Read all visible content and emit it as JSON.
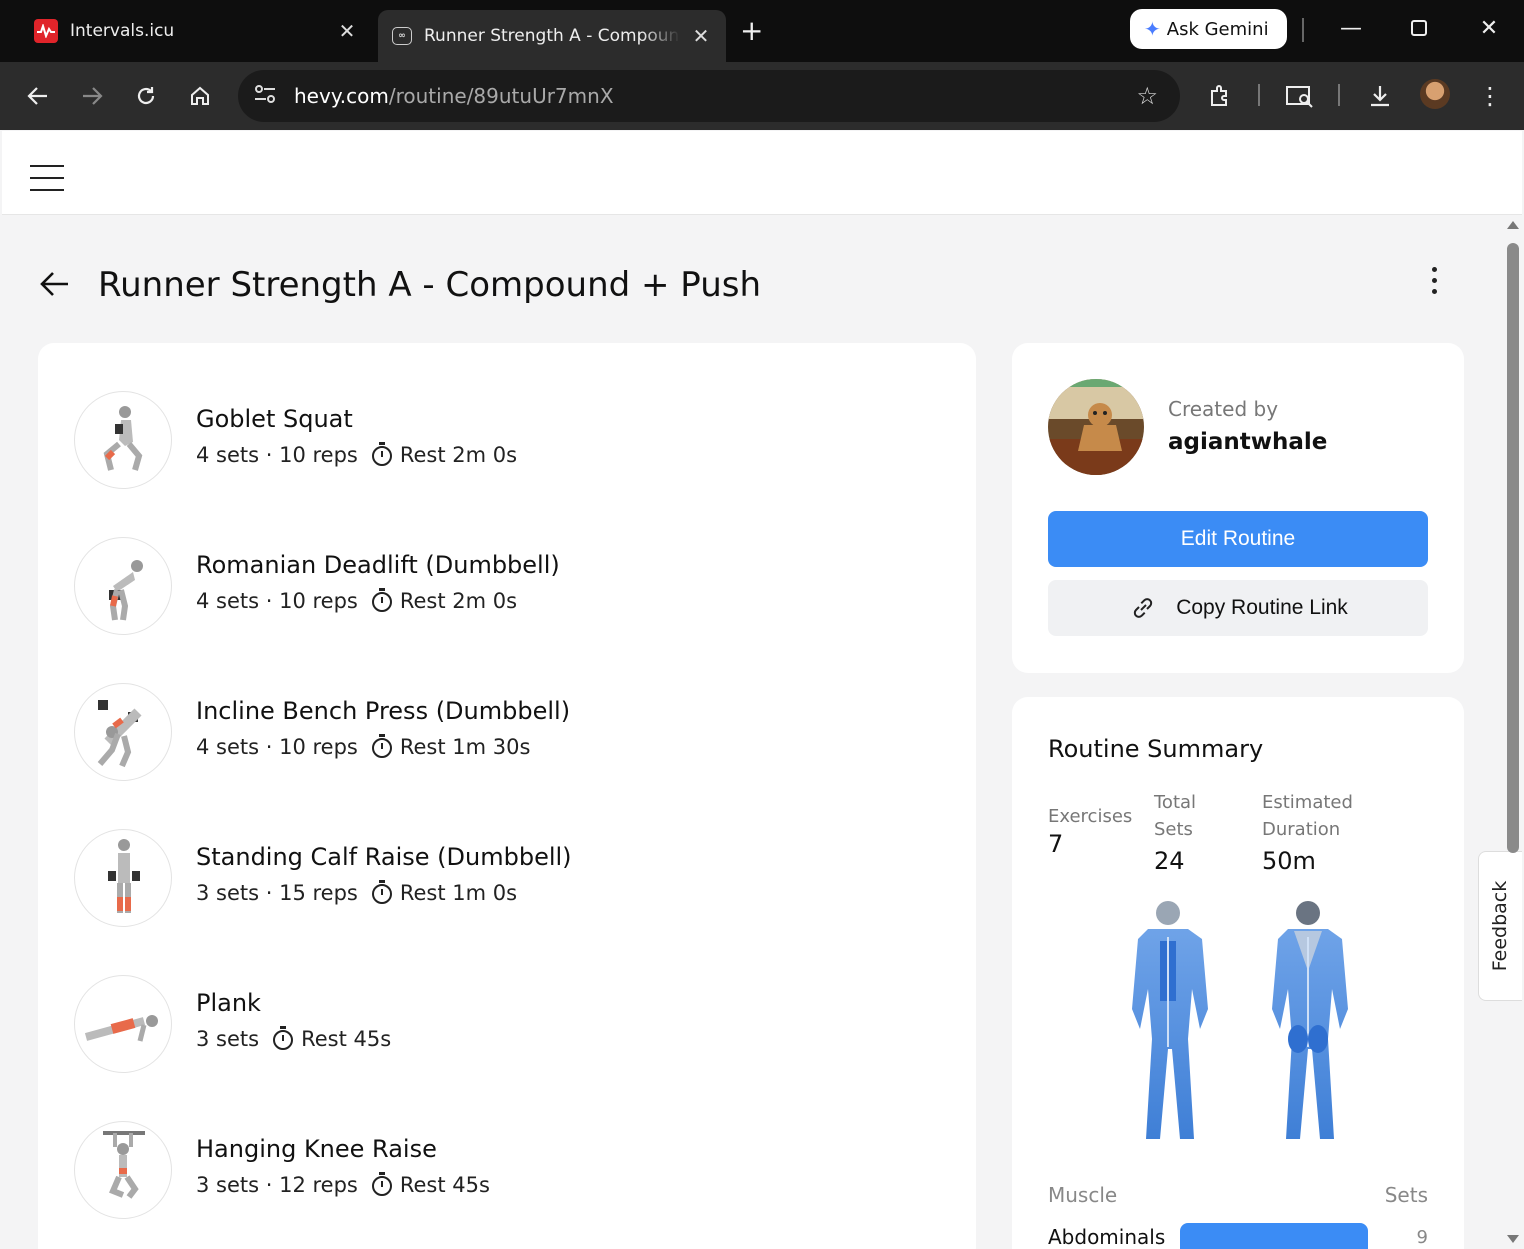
{
  "browser": {
    "tabs": [
      {
        "title": "Intervals.icu",
        "active": false
      },
      {
        "title": "Runner Strength A - Compound + Push",
        "active": true
      }
    ],
    "gemini_label": "Ask Gemini",
    "url_host": "hevy.com",
    "url_path": "/routine/89utuUr7mnX"
  },
  "page": {
    "title": "Runner Strength A - Compound + Push"
  },
  "exercises": [
    {
      "name": "Goblet Squat",
      "sets_reps": "4 sets · 10 reps",
      "rest": "Rest 2m 0s"
    },
    {
      "name": "Romanian Deadlift (Dumbbell)",
      "sets_reps": "4 sets · 10 reps",
      "rest": "Rest 2m 0s"
    },
    {
      "name": "Incline Bench Press (Dumbbell)",
      "sets_reps": "4 sets · 10 reps",
      "rest": "Rest 1m 30s"
    },
    {
      "name": "Standing Calf Raise (Dumbbell)",
      "sets_reps": "3 sets · 15 reps",
      "rest": "Rest 1m 0s"
    },
    {
      "name": "Plank",
      "sets_reps": "3 sets",
      "rest": "Rest 45s"
    },
    {
      "name": "Hanging Knee Raise",
      "sets_reps": "3 sets · 12 reps",
      "rest": "Rest 45s"
    }
  ],
  "creator": {
    "label": "Created by",
    "name": "agiantwhale",
    "edit_label": "Edit Routine",
    "copy_label": "Copy Routine Link"
  },
  "summary": {
    "title": "Routine Summary",
    "exercises_label": "Exercises",
    "exercises_value": "7",
    "total_sets_label": "Total Sets",
    "total_sets_value": "24",
    "duration_label": "Estimated Duration",
    "duration_value": "50m",
    "muscle_header": "Muscle",
    "sets_header": "Sets",
    "muscles": [
      {
        "name": "Abdominals",
        "sets": "9"
      }
    ]
  },
  "feedback_label": "Feedback",
  "colors": {
    "accent": "#3b8cf5",
    "tab_bar": "#0e0e0e",
    "toolbar": "#2c2c2c"
  }
}
